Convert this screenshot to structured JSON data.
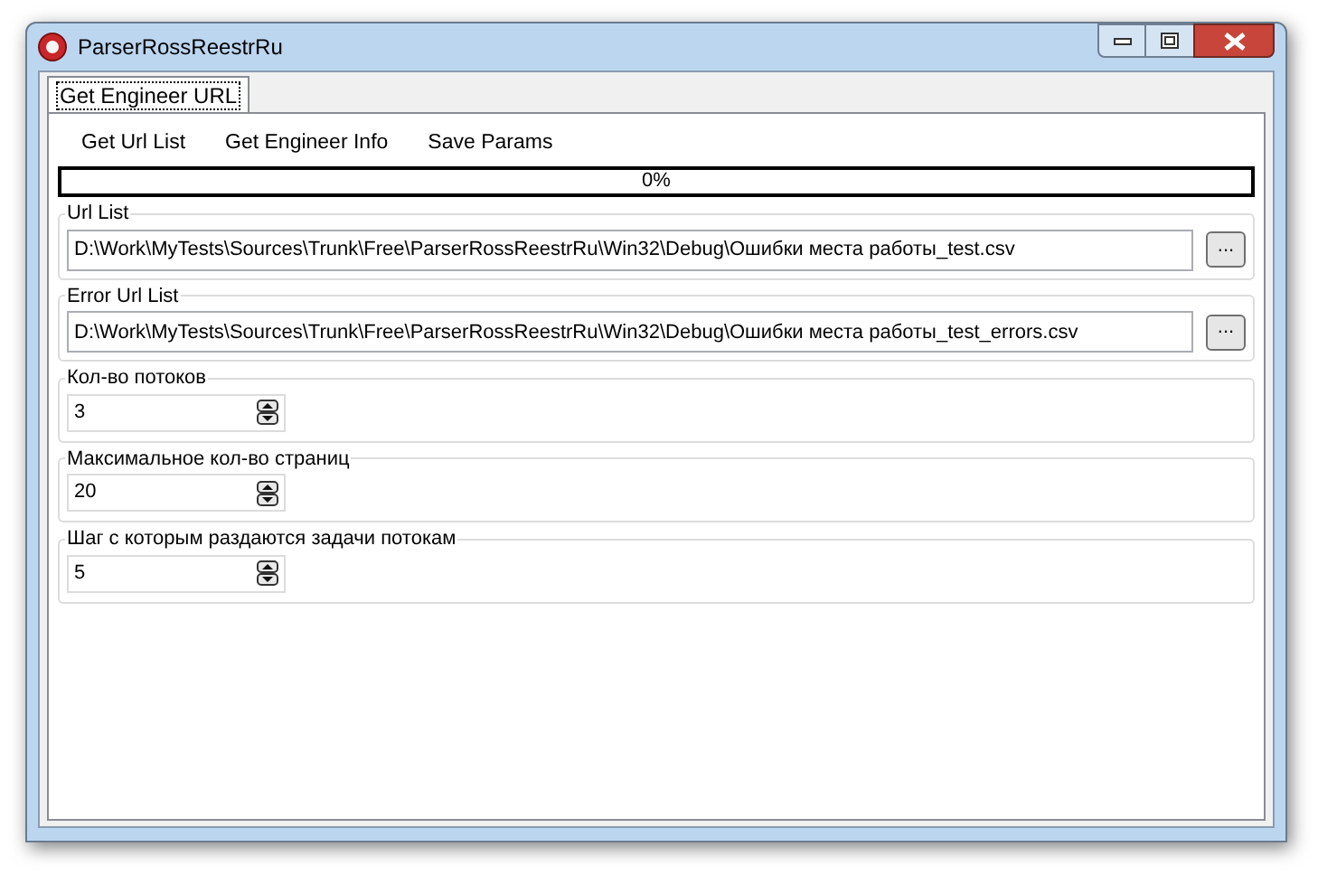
{
  "window": {
    "title": "ParserRossReestrRu"
  },
  "tabs": [
    {
      "label": "Get Engineer URL",
      "selected": true
    }
  ],
  "menu": [
    "Get Url List",
    "Get Engineer Info",
    "Save Params"
  ],
  "progress": {
    "level": 0,
    "reading": "0%"
  },
  "file_groups": [
    {
      "label": "Url List",
      "value": "D:\\Work\\MyTests\\Sources\\Trunk\\Free\\ParserRossReestrRu\\Win32\\Debug\\Ошибки места работы_test.csv",
      "browse": "..."
    },
    {
      "label": "Error Url List",
      "value": "D:\\Work\\MyTests\\Sources\\Trunk\\Free\\ParserRossReestrRu\\Win32\\Debug\\Ошибки места работы_test_errors.csv",
      "browse": "..."
    }
  ],
  "spin_groups": [
    {
      "label": "Кол-во потоков",
      "value": "3"
    },
    {
      "label": "Максимальное кол-во страниц",
      "value": "20"
    },
    {
      "label": "Шаг с которым раздаются задачи потокам",
      "value": "5"
    }
  ]
}
